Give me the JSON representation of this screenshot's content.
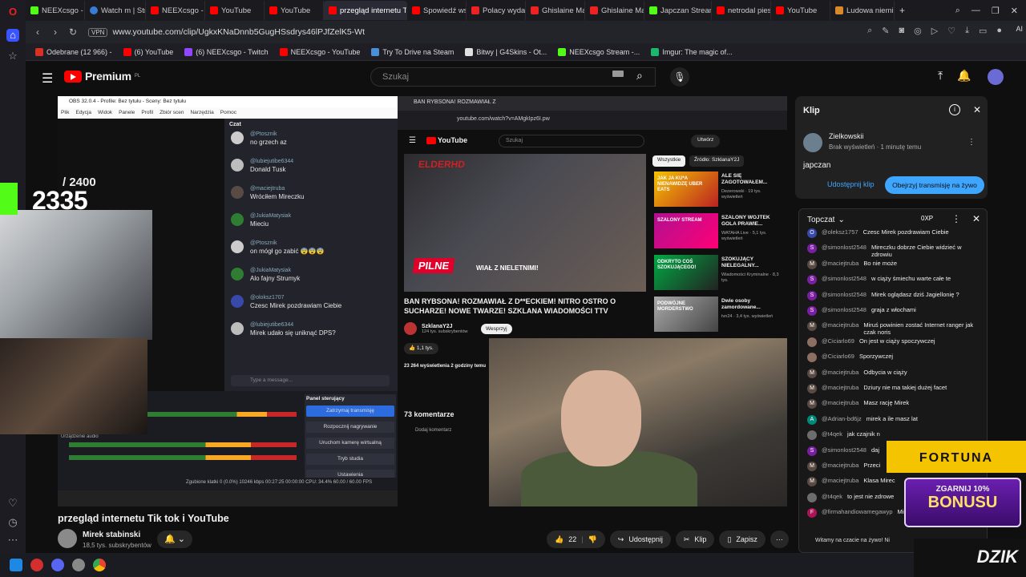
{
  "browser": {
    "tabs": [
      {
        "label": "NEEXcsgo - Strea",
        "icon": "kick"
      },
      {
        "label": "Watch m | Strea",
        "icon": "globe"
      },
      {
        "label": "NEEXcsgo - You",
        "icon": "yt"
      },
      {
        "label": "YouTube",
        "icon": "yt"
      },
      {
        "label": "YouTube",
        "icon": "yt"
      },
      {
        "label": "przegląd internetu Tik",
        "icon": "yt",
        "active": true
      },
      {
        "label": "Spowiedź wszy",
        "icon": "yt"
      },
      {
        "label": "Polacy wydają w",
        "icon": "red"
      },
      {
        "label": "Ghislaine Maxw",
        "icon": "red"
      },
      {
        "label": "Ghislaine Maxw",
        "icon": "red"
      },
      {
        "label": "Japczan Stream",
        "icon": "kick"
      },
      {
        "label": "netrodal pies -",
        "icon": "yt"
      },
      {
        "label": "YouTube",
        "icon": "yt"
      },
      {
        "label": "Ludowa niemie",
        "icon": "ora"
      }
    ],
    "vpn": "VPN",
    "url": "www.youtube.com/clip/UgkxKNaDnnb5GugHSsdrys46lPJfZelK5-Wt",
    "ai_label": "AI",
    "bookmarks": [
      "Odebrane (12 966) -",
      "(6) YouTube",
      "(6) NEEXcsgo - Twitch",
      "NEEXcsgo - YouTube",
      "Try To Drive na Steam",
      "Bitwy | G4Skins - Ot...",
      "NEEXcsgo Stream -...",
      "Imgur: The magic of..."
    ]
  },
  "youtube": {
    "logo_text": "Premium",
    "logo_region": "PL",
    "search_placeholder": "Szukaj"
  },
  "video": {
    "score_total": "/ 2400",
    "score_now": "2335",
    "obs": {
      "title": "OBS 32.0.4 - Profile: Bez tytułu - Sceny: Bez tytułu",
      "menu": [
        "Plik",
        "Edycja",
        "Widok",
        "Panele",
        "Profil",
        "Zbiór scen",
        "Narzędzia",
        "Pomoc"
      ],
      "chat_title": "Czat",
      "chat": [
        {
          "name": "@Ptosznik",
          "text": "no grzech az",
          "color": "#cccccc"
        },
        {
          "name": "@lubiejutibe6344",
          "text": "Donald Tusk",
          "color": "#bdbdbd"
        },
        {
          "name": "@maciejtruba",
          "text": "Wróciłem Mireczku",
          "color": "#5a4a44"
        },
        {
          "name": "@JukiaMatysiak",
          "text": "Mieciu",
          "color": "#2e7d32"
        },
        {
          "name": "@Ptosznik",
          "text": "on mógł go zabić 😨😨😨",
          "color": "#cccccc"
        },
        {
          "name": "@JukiaMatysiak",
          "text": "Alo fajny Strumyk",
          "color": "#2e7d32"
        },
        {
          "name": "@oloksz1707",
          "text": "Czesc Mirek pozdrawiam Ciebie",
          "color": "#3949ab"
        },
        {
          "name": "@lubiejutibe6344",
          "text": "Mirek udało się uniknąć DPS?",
          "color": "#bdbdbd"
        }
      ],
      "chat_input": "Type a message...",
      "control_title": "Panel sterujący",
      "controls": [
        "Zatrzymaj transmisję",
        "Rozpocznij nagrywanie",
        "Uruchom kamerę wirtualną",
        "Tryb studia",
        "Ustawienia"
      ],
      "status": "Zgubione klatki 0 (0.0%)    10246 kbps    00:27:25    00:00:00    CPU: 34.4%    60.00 / 60.00 FPS",
      "audio_label": "Urządzenie audio"
    },
    "inner": {
      "tab_label": "BAN RYBSONA! ROZMAWIAŁ Z",
      "url": "youtube.com/watch?v=AMgkIpz6I.pw",
      "search": "Szukaj",
      "create": "Utwórz",
      "logo": "YouTube",
      "elder": "ELDERHD",
      "pilne": "PILNE",
      "pilne_caption": "WIAŁ Z NIELETNIMI!",
      "title": "BAN RYBSONA! ROZMAWIAŁ Z D**ECKIEM! NITRO OSTRO O SUCHARZE! NOWE TWARZE! SZKLANA WIADOMOŚCI TTV",
      "channel": "SzklanaY2J",
      "channel_subs": "124 tys. subskrybentów",
      "subscribe": "Wesprzyj",
      "likes": "1,1 tys.",
      "views": "23 264 wyświetlenia  2 godziny temu",
      "comments_count": "73 komentarze",
      "add_comment": "Dodaj komentarz",
      "chips": [
        "Wszystkie",
        "Źródło: SzklanaY2J"
      ],
      "recs": [
        {
          "title": "ALE SIĘ ZAGOTOWAŁEM...",
          "meta": "Dezerowski · 19 tys. wyświetleń"
        },
        {
          "title": "SZALONY WOJTEK GOLA PRAWIE...",
          "meta": "WATAHA Live · 5,1 tys. wyświetleń"
        },
        {
          "title": "SZOKUJĄCY NIELEGALNY...",
          "meta": "Wiadomości Kryminalne · 8,3 tys."
        },
        {
          "title": "Dwie osoby zamordowane...",
          "meta": "tvn24 · 3,4 tys. wyświetleń"
        }
      ],
      "rec_badges": [
        "JAK JA KU*A NIENAWIDZĘ UBER EATS",
        "SZALONY STREAM",
        "ODKRYTO COŚ SZOKUJĄCEGO!",
        "PODWÓJNE MORDERSTWO"
      ]
    }
  },
  "below": {
    "title": "przegląd internetu Tik tok i YouTube",
    "channel": "Mirek stabinski",
    "subs": "18,5 tys. subskrybentów",
    "likes": "22",
    "share": "Udostępnij",
    "clip": "Klip",
    "save": "Zapisz"
  },
  "clip_panel": {
    "title": "Klip",
    "user": "Zielkowskii",
    "meta": "Brak wyświetleń · 1 minutę temu",
    "name": "japczan",
    "share_btn": "Udostępnij klip",
    "watch_btn": "Obejrzyj transmisję na żywo"
  },
  "livechat": {
    "title": "Topczat",
    "xp": "0XP",
    "messages": [
      {
        "name": "@oleksz1757",
        "text": "Czesc Mirek pozdrawiam Ciebie",
        "color": "#3949ab",
        "init": "O"
      },
      {
        "name": "@simonlost2548",
        "text": "Mireczku dobrze Ciebie widzieć w zdrowiu",
        "color": "#7b1fa2",
        "init": "S"
      },
      {
        "name": "@maciejtruba",
        "text": "Bo nie może",
        "color": "#5a4a44",
        "init": "M"
      },
      {
        "name": "@simonlost2548",
        "text": "w ciąży śmiechu warte całe te",
        "color": "#7b1fa2",
        "init": "S"
      },
      {
        "name": "@simonlost2548",
        "text": "Mirek oglądasz dziś Jagiellonię ?",
        "color": "#7b1fa2",
        "init": "S"
      },
      {
        "name": "@simonlost2548",
        "text": "graja z włochami",
        "color": "#7b1fa2",
        "init": "S"
      },
      {
        "name": "@maciejtruba",
        "text": "Miruś powinien zostać Internet ranger jak czak noris",
        "color": "#5a4a44",
        "init": "M"
      },
      {
        "name": "@Ciciarlo69",
        "text": "On jest w ciąży spoczywczej",
        "color": "#8d6e63",
        "init": ""
      },
      {
        "name": "@Ciciarlo69",
        "text": "Sporzywczej",
        "color": "#8d6e63",
        "init": ""
      },
      {
        "name": "@maciejtruba",
        "text": "Odbycia w ciąży",
        "color": "#5a4a44",
        "init": "M"
      },
      {
        "name": "@maciejtruba",
        "text": "Dziury nie ma takiej dużej facet",
        "color": "#5a4a44",
        "init": "M"
      },
      {
        "name": "@maciejtruba",
        "text": "Masz rację Mirek",
        "color": "#5a4a44",
        "init": "M"
      },
      {
        "name": "@Adrian-bd6jz",
        "text": "mirek a ile masz lat",
        "color": "#00897b",
        "init": "A"
      },
      {
        "name": "@t4qek",
        "text": "jak czajnik n",
        "color": "#6d6d6d",
        "init": ""
      },
      {
        "name": "@simonlost2548",
        "text": "daj",
        "color": "#7b1fa2",
        "init": "S"
      },
      {
        "name": "@maciejtruba",
        "text": "Przeci",
        "color": "#5a4a44",
        "init": "M"
      },
      {
        "name": "@maciejtruba",
        "text": "Klasa Mirec",
        "color": "#5a4a44",
        "init": "M"
      },
      {
        "name": "@t4qek",
        "text": "to jest nie zdrowe",
        "color": "#6d6d6d",
        "init": ""
      },
      {
        "name": "@firmahandiowamegawyp",
        "text": "Mirku daje suba , pozdrów sw",
        "color": "#ad1457",
        "init": "F"
      }
    ],
    "welcome": "Witamy na czacie na żywo! Ni"
  },
  "ads": {
    "fortuna": "FORTUNA",
    "bonus_top": "ZGARNIJ 10%",
    "bonus_main": "BONUSU",
    "dzik": "DZIK"
  }
}
